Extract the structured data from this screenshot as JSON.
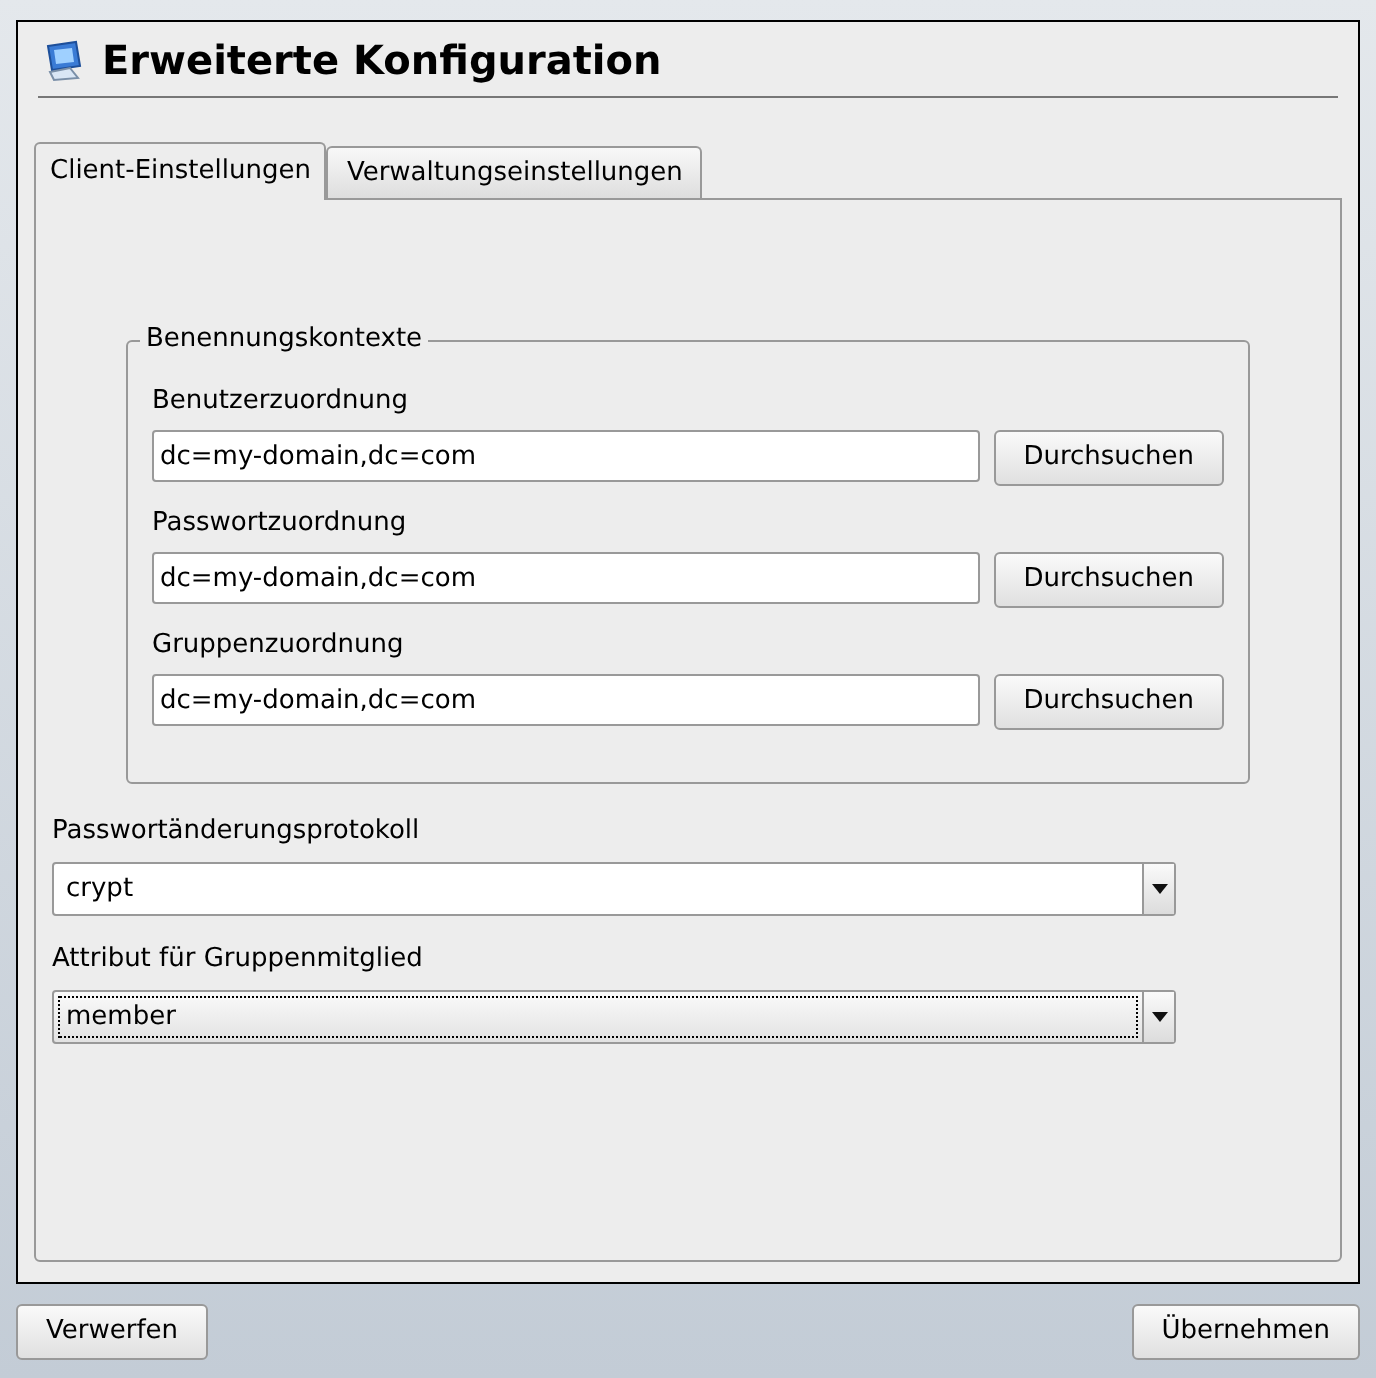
{
  "window": {
    "title": "Erweiterte Konfiguration"
  },
  "tabs": [
    {
      "label": "Client-Einstellungen",
      "selected": true
    },
    {
      "label": "Verwaltungseinstellungen",
      "selected": false
    }
  ],
  "group": {
    "title": "Benennungskontexte",
    "rows": [
      {
        "label": "Benutzerzuordnung",
        "value": "dc=my-domain,dc=com",
        "button": "Durchsuchen"
      },
      {
        "label": "Passwortzuordnung",
        "value": "dc=my-domain,dc=com",
        "button": "Durchsuchen"
      },
      {
        "label": "Gruppenzuordnung",
        "value": "dc=my-domain,dc=com",
        "button": "Durchsuchen"
      }
    ]
  },
  "combos": [
    {
      "label": "Passwortänderungsprotokoll",
      "value": "crypt",
      "focused": false
    },
    {
      "label": "Attribut für Gruppenmitglied",
      "value": "member",
      "focused": true
    }
  ],
  "buttons": [
    "Verwerfen",
    "Übernehmen"
  ]
}
